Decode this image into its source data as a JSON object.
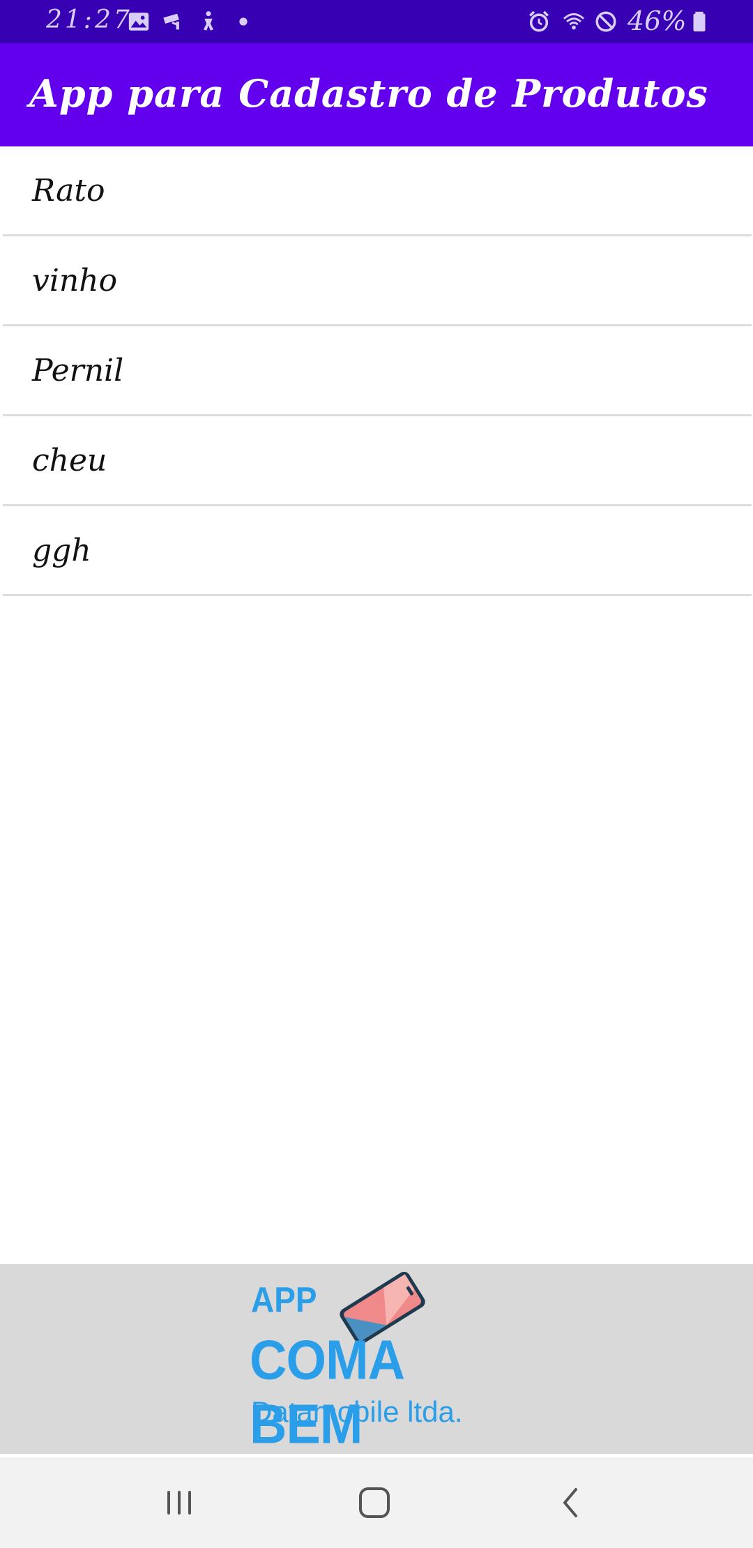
{
  "status_bar": {
    "time": "21:27",
    "battery_percent": "46%",
    "left_icons": [
      "image-icon",
      "cctv-icon",
      "accessibility-icon",
      "dot-icon"
    ],
    "right_icons": [
      "alarm-icon",
      "wifi-icon",
      "do-not-disturb-icon",
      "battery-icon"
    ]
  },
  "app_bar": {
    "title": "App para Cadastro de Produtos"
  },
  "products": [
    {
      "name": "Rato"
    },
    {
      "name": "vinho"
    },
    {
      "name": "Pernil"
    },
    {
      "name": "cheu"
    },
    {
      "name": "ggh"
    }
  ],
  "banner": {
    "app_label": "APP",
    "app_name": "COMA BEM",
    "company": "Datamobile ltda."
  },
  "nav_bar": {
    "buttons": [
      "recent-apps",
      "home",
      "back"
    ]
  },
  "colors": {
    "status_bar": "#3700b3",
    "app_bar": "#6200ee",
    "banner_text": "#2a9ee8",
    "banner_bg": "#d9d9d9"
  }
}
